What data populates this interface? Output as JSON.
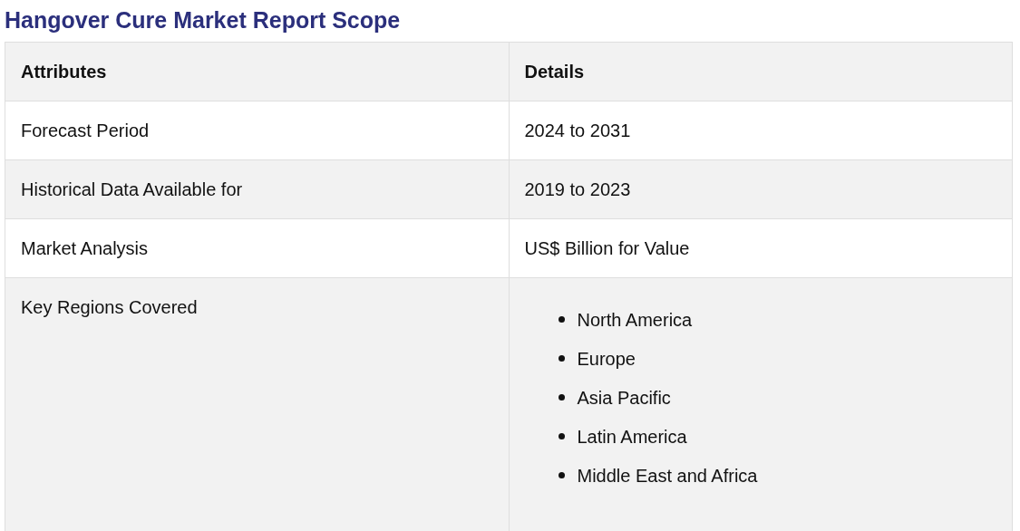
{
  "title": "Hangover Cure Market Report Scope",
  "table": {
    "columns": [
      "Attributes",
      "Details"
    ],
    "rows": [
      {
        "attribute": "Forecast Period",
        "details": "2024 to 2031"
      },
      {
        "attribute": "Historical Data Available for",
        "details": "2019 to 2023"
      },
      {
        "attribute": "Market Analysis",
        "details": "US$ Billion for Value"
      },
      {
        "attribute": "Key Regions Covered",
        "details_list": [
          "North America",
          "Europe",
          "Asia Pacific",
          "Latin America",
          "Middle East and Africa"
        ]
      }
    ]
  }
}
